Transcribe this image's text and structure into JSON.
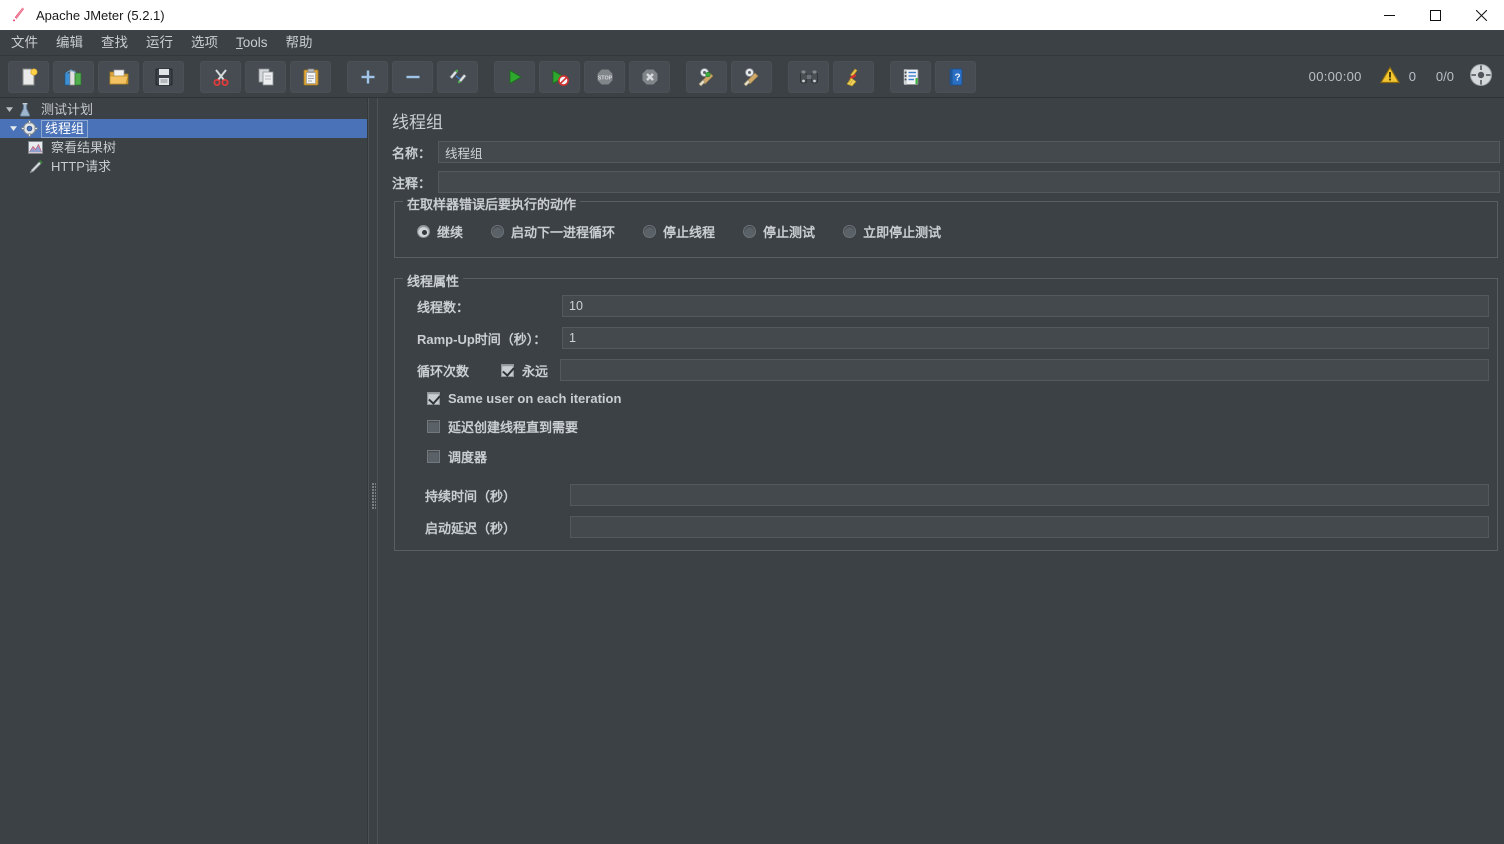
{
  "window": {
    "title": "Apache JMeter (5.2.1)",
    "app_icon": "jmeter-feather-icon",
    "minimize_label": "—",
    "maximize_label": "□",
    "close_label": "✕"
  },
  "menubar": {
    "items": [
      {
        "label": "文件",
        "name": "menu-file"
      },
      {
        "label": "编辑",
        "name": "menu-edit"
      },
      {
        "label": "查找",
        "name": "menu-search"
      },
      {
        "label": "运行",
        "name": "menu-run"
      },
      {
        "label": "选项",
        "name": "menu-options"
      },
      {
        "label": "Tools",
        "name": "menu-tools",
        "mnemonic": "T"
      },
      {
        "label": "帮助",
        "name": "menu-help"
      }
    ]
  },
  "toolbar": {
    "buttons": [
      {
        "name": "new-button",
        "icon": "new-document-icon",
        "tooltip": "新建"
      },
      {
        "name": "templates-button",
        "icon": "templates-books-icon",
        "tooltip": "模板"
      },
      {
        "name": "open-button",
        "icon": "open-folder-icon",
        "tooltip": "打开"
      },
      {
        "name": "save-button",
        "icon": "save-floppy-icon",
        "tooltip": "保存"
      },
      {
        "name": "cut-button",
        "icon": "scissors-icon",
        "tooltip": "剪切"
      },
      {
        "name": "copy-button",
        "icon": "copy-pages-icon",
        "tooltip": "复制"
      },
      {
        "name": "paste-button",
        "icon": "clipboard-paste-icon",
        "tooltip": "粘贴"
      },
      {
        "name": "expand-all-button",
        "icon": "plus-icon",
        "tooltip": "展开全部"
      },
      {
        "name": "collapse-all-button",
        "icon": "minus-icon",
        "tooltip": "折叠全部"
      },
      {
        "name": "toggle-button",
        "icon": "toggle-pencils-icon",
        "tooltip": "切换"
      },
      {
        "name": "start-button",
        "icon": "play-green-icon",
        "tooltip": "启动"
      },
      {
        "name": "start-no-pauses-button",
        "icon": "play-no-pause-icon",
        "tooltip": "无间隔启动"
      },
      {
        "name": "stop-button",
        "icon": "stop-sign-icon",
        "tooltip": "停止"
      },
      {
        "name": "shutdown-button",
        "icon": "shutdown-x-icon",
        "tooltip": "关闭"
      },
      {
        "name": "clear-button",
        "icon": "gear-broom-green-icon",
        "tooltip": "清除"
      },
      {
        "name": "clear-all-button",
        "icon": "gear-broom-icon",
        "tooltip": "清除全部"
      },
      {
        "name": "search-button",
        "icon": "binoculars-icon",
        "tooltip": "搜索"
      },
      {
        "name": "reset-search-button",
        "icon": "broom-icon",
        "tooltip": "重置搜索"
      },
      {
        "name": "function-helper-button",
        "icon": "function-list-icon",
        "tooltip": "函数助手"
      },
      {
        "name": "help-button",
        "icon": "help-book-icon",
        "tooltip": "帮助"
      }
    ],
    "status": {
      "elapsed_time": "00:00:00",
      "warning_icon": "warning-triangle-icon",
      "warning_count": "0",
      "threads": "0/0",
      "connect_icon": "connection-status-icon"
    }
  },
  "tree": {
    "nodes": [
      {
        "label": "测试计划",
        "icon": "test-plan-flask-icon",
        "expanded": true,
        "level": 1,
        "selected": false,
        "name": "tree-node-test-plan"
      },
      {
        "label": "线程组",
        "icon": "thread-group-gear-icon",
        "expanded": true,
        "level": 2,
        "selected": true,
        "name": "tree-node-thread-group"
      },
      {
        "label": "察看结果树",
        "icon": "view-results-tree-icon",
        "expanded": false,
        "level": 3,
        "selected": false,
        "name": "tree-node-view-results-tree"
      },
      {
        "label": "HTTP请求",
        "icon": "http-request-pen-icon",
        "expanded": false,
        "level": 3,
        "selected": false,
        "name": "tree-node-http-request"
      }
    ]
  },
  "detail": {
    "title": "线程组",
    "name_label": "名称：",
    "name_value": "线程组",
    "comment_label": "注释：",
    "comment_value": "",
    "error_action": {
      "legend": "在取样器错误后要执行的动作",
      "options": [
        {
          "label": "继续",
          "checked": true,
          "name": "radio-continue"
        },
        {
          "label": "启动下一进程循环",
          "checked": false,
          "name": "radio-start-next-loop"
        },
        {
          "label": "停止线程",
          "checked": false,
          "name": "radio-stop-thread"
        },
        {
          "label": "停止测试",
          "checked": false,
          "name": "radio-stop-test"
        },
        {
          "label": "立即停止测试",
          "checked": false,
          "name": "radio-stop-test-now"
        }
      ]
    },
    "thread_props": {
      "legend": "线程属性",
      "num_threads_label": "线程数：",
      "num_threads_value": "10",
      "ramp_up_label": "Ramp-Up时间（秒）：",
      "ramp_up_value": "1",
      "loop_count_label": "循环次数",
      "forever_label": "永远",
      "forever_checked": true,
      "loop_count_value": "",
      "same_user_label": "Same user on each iteration",
      "same_user_checked": true,
      "delayed_start_label": "延迟创建线程直到需要",
      "delayed_start_checked": false,
      "scheduler_label": "调度器",
      "scheduler_checked": false,
      "duration_label": "持续时间（秒）",
      "duration_value": "",
      "startup_delay_label": "启动延迟（秒）",
      "startup_delay_value": ""
    }
  },
  "colors": {
    "window_bg": "#3c4145",
    "titlebar_bg": "#ffffff",
    "selection_blue": "#4a72b8",
    "text": "#c9ced2",
    "field_bg": "#44494e",
    "border": "#585e63"
  }
}
